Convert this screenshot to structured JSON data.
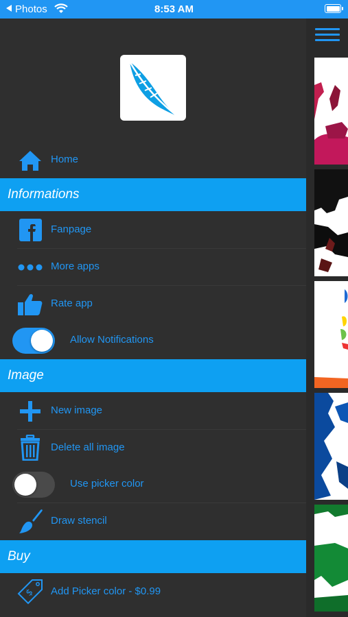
{
  "status_bar": {
    "back_label": "Photos",
    "time": "8:53 AM"
  },
  "menu": {
    "home": {
      "label": "Home",
      "icon": "home-icon"
    },
    "sections": {
      "informations": "Informations",
      "image": "Image",
      "buy": "Buy"
    },
    "fanpage": {
      "label": "Fanpage",
      "icon": "facebook-icon"
    },
    "more_apps": {
      "label": "More apps",
      "icon": "more-dots-icon"
    },
    "rate_app": {
      "label": "Rate app",
      "icon": "thumbs-up-icon"
    },
    "allow_notifications": {
      "label": "Allow Notifications",
      "on": true
    },
    "new_image": {
      "label": "New image",
      "icon": "plus-icon"
    },
    "delete_all": {
      "label": "Delete all image",
      "icon": "trash-icon"
    },
    "use_picker_color": {
      "label": "Use picker color",
      "on": false
    },
    "draw_stencil": {
      "label": "Draw stencil",
      "icon": "brush-icon"
    },
    "add_picker": {
      "label": "Add Picker color - $0.99",
      "icon": "price-tag-icon"
    }
  },
  "colors": {
    "accent": "#2196f3",
    "section_bg": "#0ea0f2",
    "drawer_bg": "#2f2f2f"
  }
}
